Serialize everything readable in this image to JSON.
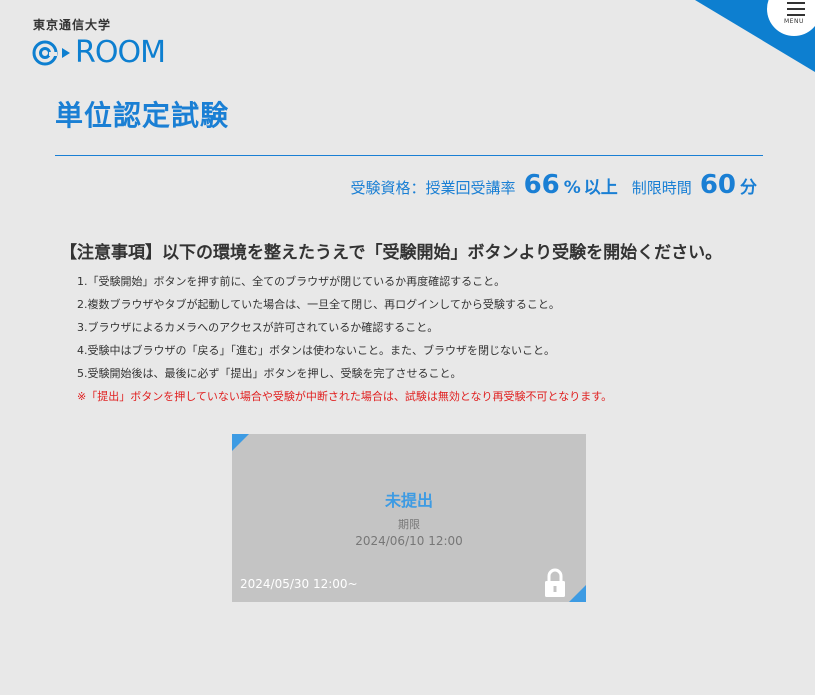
{
  "header": {
    "university_name": "東京通信大学",
    "logo_text": "ROOM",
    "menu_label": "MENU"
  },
  "page": {
    "title": "単位認定試験"
  },
  "requirements": {
    "qualification_label": "受験資格：授業回受講率",
    "attendance_value": "66",
    "attendance_unit": "%",
    "attendance_suffix": "以上",
    "time_limit_label": "制限時間",
    "time_limit_value": "60",
    "time_limit_unit": "分"
  },
  "notice": {
    "heading": "【注意事項】以下の環境を整えたうえで「受験開始」ボタンより受験を開始ください。",
    "items": [
      "1.「受験開始」ボタンを押す前に、全てのブラウザが閉じているか再度確認すること。",
      "2.複数ブラウザやタブが起動していた場合は、一旦全て閉じ、再ログインしてから受験すること。",
      "3.ブラウザによるカメラへのアクセスが許可されているか確認すること。",
      "4.受験中はブラウザの「戻る」「進む」ボタンは使わないこと。また、ブラウザを閉じないこと。",
      "5.受験開始後は、最後に必ず「提出」ボタンを押し、受験を完了させること。"
    ],
    "warning": "※「提出」ボタンを押していない場合や受験が中断された場合は、試験は無効となり再受験不可となります。"
  },
  "exam_card": {
    "status": "未提出",
    "deadline_label": "期限",
    "deadline": "2024/06/10 12:00",
    "start": "2024/05/30 12:00~",
    "lock_icon": "lock-icon"
  },
  "colors": {
    "accent": "#1a7fd4",
    "card_accent": "#3d9be3",
    "warning": "#e02020",
    "background": "#e8e8e8",
    "card_background": "#c4c4c4"
  }
}
